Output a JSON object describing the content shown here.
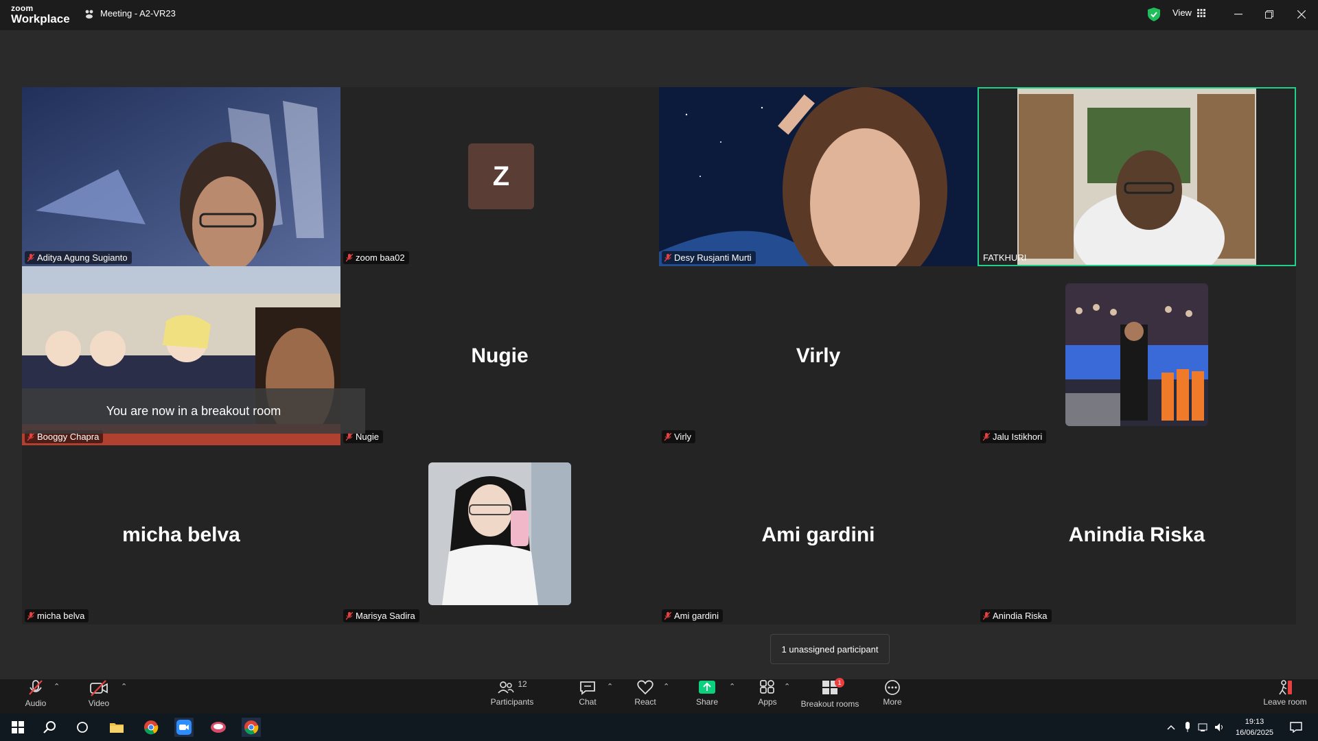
{
  "app": {
    "logo_line1": "zoom",
    "logo_line2": "Workplace",
    "meeting_title": "Meeting - A2-VR23",
    "view_label": "View"
  },
  "participants": [
    {
      "name": "Aditya Agung Sugianto",
      "type": "video",
      "muted": true
    },
    {
      "name": "zoom baa02",
      "type": "avatar",
      "initial": "Z",
      "muted": true
    },
    {
      "name": "Desy Rusjanti Murti",
      "type": "video",
      "muted": true
    },
    {
      "name": "FATKHURI",
      "type": "video",
      "muted": false,
      "active_speaker": true
    },
    {
      "name": "Booggy Chapra",
      "type": "video",
      "muted": true
    },
    {
      "name": "Nugie",
      "type": "name",
      "display": "Nugie",
      "muted": true
    },
    {
      "name": "Virly",
      "type": "name",
      "display": "Virly",
      "muted": true
    },
    {
      "name": "Jalu Istikhori",
      "type": "photo",
      "muted": true
    },
    {
      "name": "micha belva",
      "type": "name",
      "display": "micha belva",
      "muted": true
    },
    {
      "name": "Marisya Sadira",
      "type": "photo",
      "muted": true
    },
    {
      "name": "Ami gardini",
      "type": "name",
      "display": "Ami gardini",
      "muted": true
    },
    {
      "name": "Anindia Riska",
      "type": "name",
      "display": "Anindia Riska",
      "muted": true
    }
  ],
  "overlay": {
    "breakout_message": "You are now in a breakout room",
    "tooltip": "1 unassigned participant"
  },
  "toolbar": {
    "audio": "Audio",
    "video": "Video",
    "participants": "Participants",
    "participants_count": "12",
    "chat": "Chat",
    "react": "React",
    "share": "Share",
    "apps": "Apps",
    "breakout": "Breakout rooms",
    "breakout_badge": "1",
    "more": "More",
    "leave": "Leave room"
  },
  "taskbar": {
    "time": "19:13",
    "date": "16/06/2025"
  },
  "colors": {
    "active_border": "#1fd18b",
    "share_green": "#0bd07e",
    "mute_red": "#e8403f",
    "avatar_bg": "#5a3e36"
  }
}
